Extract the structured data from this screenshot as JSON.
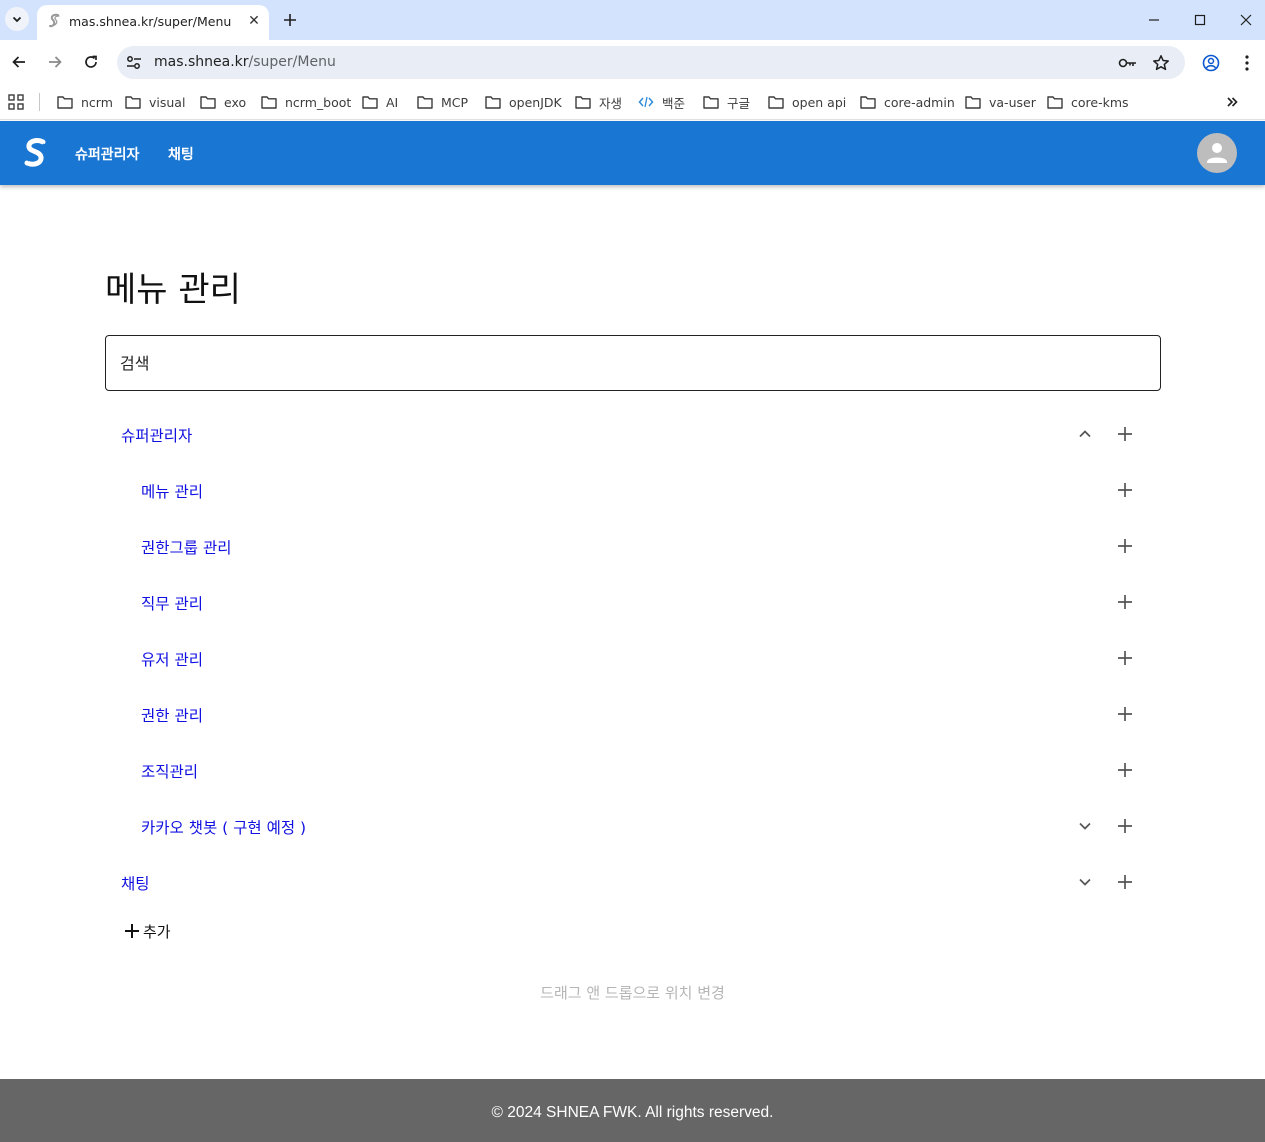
{
  "browser": {
    "tab": {
      "title": "mas.shnea.kr/super/Menu"
    },
    "address": {
      "host": "mas.shnea.kr",
      "path": "/super/Menu"
    },
    "bookmarks": [
      {
        "label": "ncrm",
        "icon": "folder-icon"
      },
      {
        "label": "visual",
        "icon": "folder-icon"
      },
      {
        "label": "exo",
        "icon": "folder-icon"
      },
      {
        "label": "ncrm_boot",
        "icon": "folder-icon"
      },
      {
        "label": "AI",
        "icon": "folder-icon"
      },
      {
        "label": "MCP",
        "icon": "folder-icon"
      },
      {
        "label": "openJDK",
        "icon": "folder-icon"
      },
      {
        "label": "자생",
        "icon": "folder-icon"
      },
      {
        "label": "백준",
        "icon": "code-icon"
      },
      {
        "label": "구글",
        "icon": "folder-icon"
      },
      {
        "label": "open api",
        "icon": "folder-icon"
      },
      {
        "label": "core-admin",
        "icon": "folder-icon"
      },
      {
        "label": "va-user",
        "icon": "folder-icon"
      },
      {
        "label": "core-kms",
        "icon": "folder-icon"
      }
    ]
  },
  "app": {
    "nav": [
      "슈퍼관리자",
      "채팅"
    ],
    "brand_color": "#1976d2"
  },
  "main": {
    "title": "메뉴 관리",
    "search_placeholder": "검색",
    "menu": [
      {
        "label": "슈퍼관리자",
        "level": 0,
        "toggle": "expanded"
      },
      {
        "label": "메뉴 관리",
        "level": 1,
        "toggle": "none"
      },
      {
        "label": "권한그룹 관리",
        "level": 1,
        "toggle": "none"
      },
      {
        "label": "직무 관리",
        "level": 1,
        "toggle": "none"
      },
      {
        "label": "유저 관리",
        "level": 1,
        "toggle": "none"
      },
      {
        "label": "권한 관리",
        "level": 1,
        "toggle": "none"
      },
      {
        "label": "조직관리",
        "level": 1,
        "toggle": "none"
      },
      {
        "label": "카카오 챗봇 ( 구현 예정 )",
        "level": 1,
        "toggle": "collapsed"
      },
      {
        "label": "채팅",
        "level": 0,
        "toggle": "collapsed"
      }
    ],
    "add_label": "추가",
    "hint": "드래그 앤 드롭으로 위치 변경"
  },
  "footer": {
    "text": "© 2024 SHNEA FWK. All rights reserved."
  }
}
